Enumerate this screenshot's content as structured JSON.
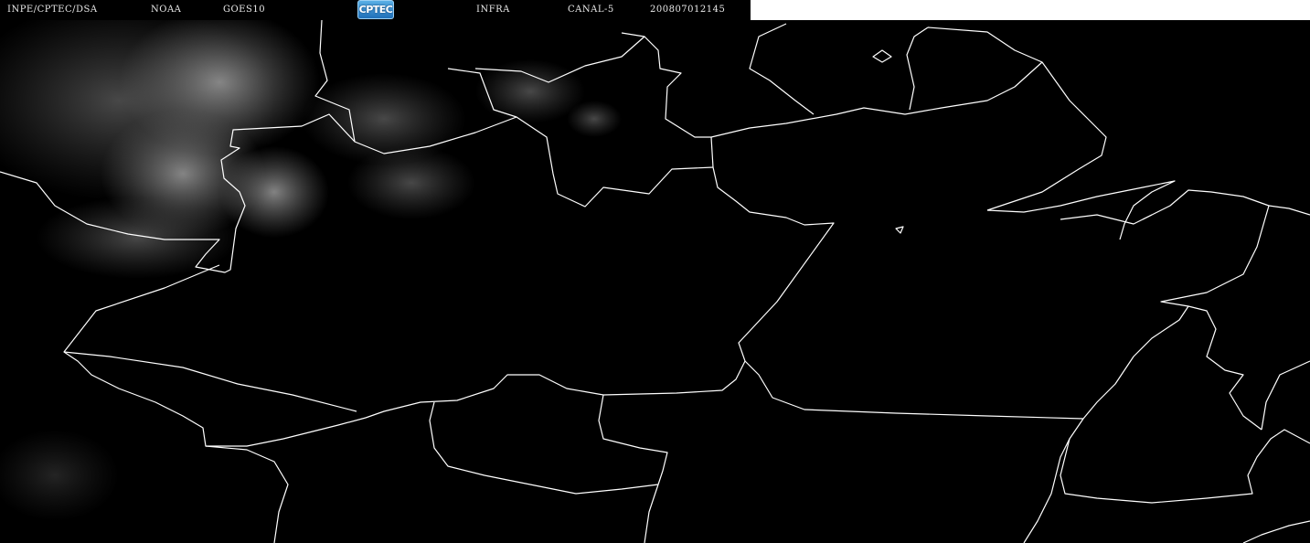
{
  "header": {
    "agency": "INPE/CPTEC/DSA",
    "source": "NOAA",
    "satellite": "GOES10",
    "logo_text": "CPTEC",
    "product": "INFRA",
    "channel": "CANAL-5",
    "timestamp": "200807012145"
  },
  "map": {
    "background_color": "#000000",
    "border_color": "#ffffff",
    "cloud_color": "#a0a0a0"
  }
}
